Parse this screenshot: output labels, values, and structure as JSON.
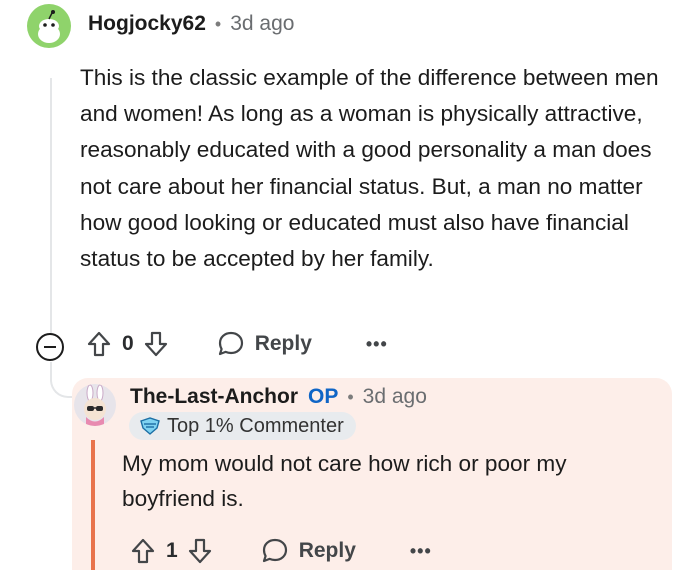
{
  "comment": {
    "username": "Hogjocky62",
    "separator": "•",
    "timestamp": "3d ago",
    "body": "This is the classic example of the difference between men and women! As long as a woman is physically attractive, reasonably educated with a good personality a man does not care about her financial status. But, a man no matter how good looking or educated must also have financial status to be accepted by her family.",
    "vote_count": "0",
    "reply_label": "Reply",
    "more_label": "•••"
  },
  "reply": {
    "username": "The-Last-Anchor",
    "op_label": "OP",
    "separator": "•",
    "timestamp": "3d ago",
    "badge_label": "Top 1% Commenter",
    "body": "My mom would not care how rich or poor my boyfriend is.",
    "vote_count": "1",
    "reply_label": "Reply",
    "more_label": "•••"
  },
  "colors": {
    "accent": "#0f65c6",
    "reply_background": "#fdeee9",
    "thread_highlight": "#e8734c",
    "avatar_green": "#8fd36b"
  },
  "icons": [
    "snoo-avatar",
    "upvote-icon",
    "downvote-icon",
    "reply-bubble-icon",
    "more-icon",
    "collapse-icon",
    "badge-icon"
  ]
}
